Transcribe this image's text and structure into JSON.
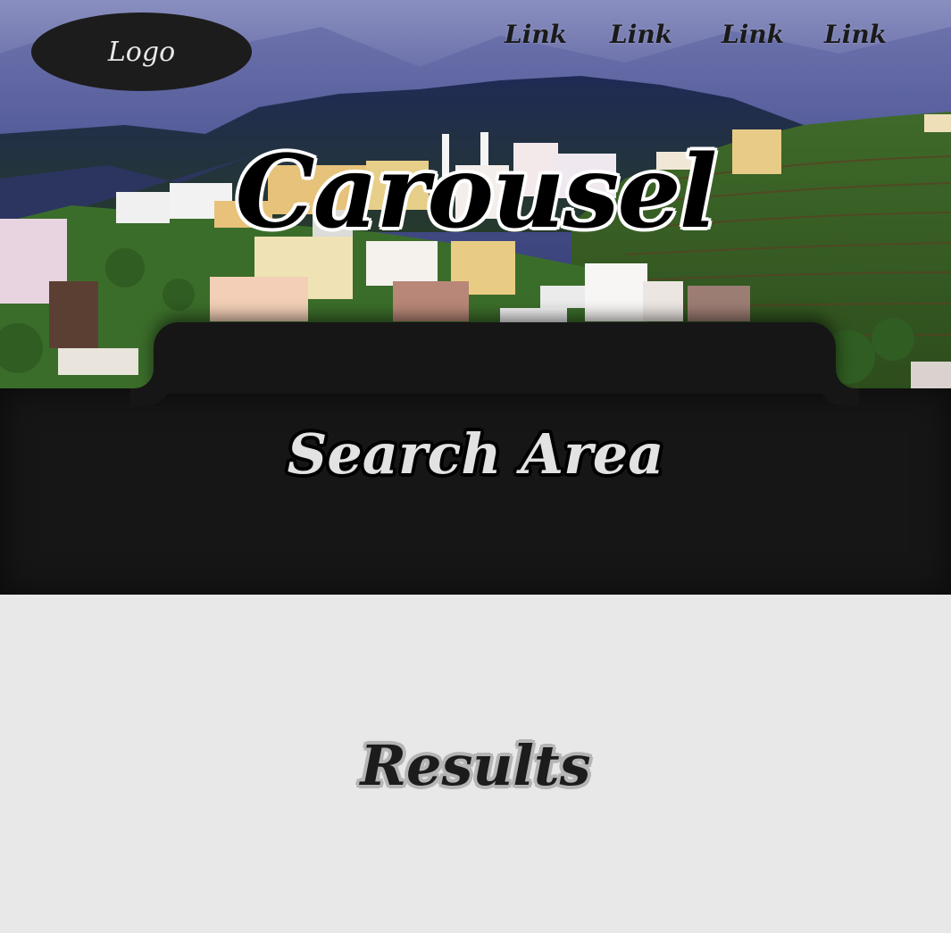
{
  "header": {
    "logo_label": "Logo",
    "nav_links": [
      {
        "label": "Link"
      },
      {
        "label": "Link"
      },
      {
        "label": "Link"
      },
      {
        "label": "Link"
      }
    ]
  },
  "carousel": {
    "title": "Carousel",
    "image_subject": "hillside-village-photo"
  },
  "search": {
    "title": "Search Area"
  },
  "results": {
    "title": "Results"
  },
  "colors": {
    "dark_panel": "#161616",
    "logo_bg": "#1c1c1c",
    "page_bg": "#e8e8e8",
    "results_text": "#1c1c1c"
  }
}
